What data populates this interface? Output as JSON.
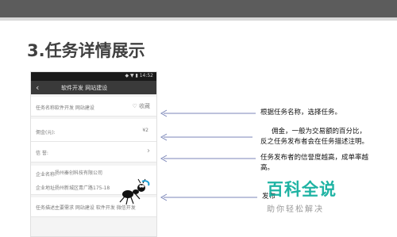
{
  "slide": {
    "title_num": "3.",
    "title_text": "任务详情展示"
  },
  "phone": {
    "status_right": "◆ ▼ ▮ 14:52",
    "back_icon": "chevron-left-icon",
    "nav_title": "软件开发  网站建设",
    "task_name_label": "任务名称:",
    "task_name_value": "软件开发  网站建设",
    "favorite_label": "♡ 收藏",
    "price_label": "佣金(元):",
    "price_value": "¥2",
    "credit_label": "信    誉:",
    "chevron": "›",
    "company_label": "企业名称:",
    "company_value": "扬州秦创科技有限公司",
    "address_label": "企业地址:",
    "address_value": "扬州新城区青广路175-18",
    "desc_label": "任务描述:",
    "desc_value": "主要需求  网站建设  软件开发  微信开发"
  },
  "annotations": {
    "note1": "根据任务名称，选择任务。",
    "note2_line1": "佣金，一般为交易额的百分比，",
    "note2_line2": "反之任务发布者会在任务描述注明。",
    "note3_line1": "任务发布者的信誉度越高，成单率越",
    "note3_line2": "高。",
    "note4": "发布"
  },
  "watermark": {
    "title": "百科全说",
    "subtitle": "助你轻松解决"
  },
  "colors": {
    "arrow": "#7b86b8",
    "watermark": "#1fb3a3",
    "topbar": "#5c5c5c"
  }
}
